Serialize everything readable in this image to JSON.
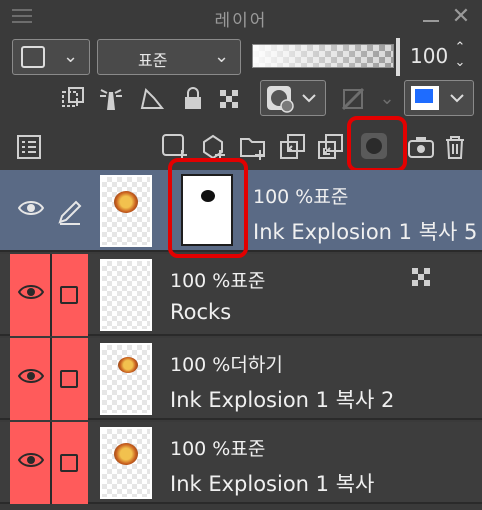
{
  "panel": {
    "title": "레이어",
    "blend_mode": "표준",
    "opacity_value": "100",
    "opacity_fraction": 0.98
  },
  "icons": {
    "row2": [
      "clip-icon",
      "reference-lighthouse-icon",
      "draft-icon",
      "lock-icon",
      "lock-transparency-icon",
      "mask-display-icon",
      "color-palette-icon",
      "layer-color-icon"
    ],
    "row3": [
      "layer-property-icon",
      "new-raster-layer-icon",
      "new-vector-layer-icon",
      "new-folder-icon",
      "transfer-down-icon",
      "combine-icon",
      "mask-icon",
      "camera-icon",
      "trash-icon"
    ]
  },
  "layers": [
    {
      "id": "layer-1",
      "line1": "100 %표준",
      "line2": "Ink Explosion 1 복사 5",
      "selected": true,
      "red": false,
      "has_mask": true
    },
    {
      "id": "layer-2",
      "line1": "100 %표준",
      "line2": "Rocks",
      "selected": false,
      "red": true,
      "has_mask": false,
      "lock_transparency": true
    },
    {
      "id": "layer-3",
      "line1": "100 %더하기",
      "line2": "Ink Explosion 1 복사 2",
      "selected": false,
      "red": true,
      "has_mask": false
    },
    {
      "id": "layer-4",
      "line1": "100 %표준",
      "line2": "Ink Explosion 1 복사",
      "selected": false,
      "red": true,
      "has_mask": false
    }
  ],
  "colors": {
    "highlight_red": "#e30000",
    "selected_row": "#5a6a85",
    "red_column": "#ff5b5b",
    "layer_color_blue": "#1e6cff"
  }
}
